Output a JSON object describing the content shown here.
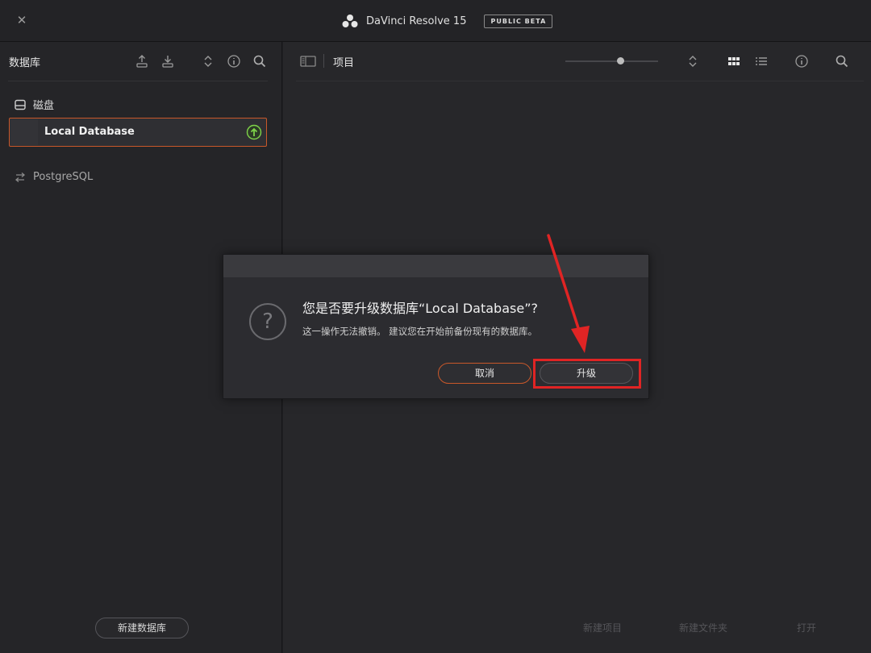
{
  "window": {
    "close_icon": "close-icon",
    "title": "DaVinci Resolve 15",
    "badge": "PUBLIC BETA"
  },
  "left_panel": {
    "title": "数据库",
    "section_label": "磁盘",
    "database_item": "Local Database",
    "network_item": "PostgreSQL",
    "new_database_button": "新建数据库"
  },
  "right_panel": {
    "title": "项目",
    "footer": {
      "new_project": "新建项目",
      "new_folder": "新建文件夹",
      "open": "打开"
    }
  },
  "dialog": {
    "title": "您是否要升级数据库“Local Database”?",
    "message": "这一操作无法撤销。 建议您在开始前备份现有的数据库。",
    "cancel_button": "取消",
    "upgrade_button": "升级"
  },
  "colors": {
    "accent_orange": "#c9582a",
    "annotation_red": "#e02424",
    "upgrade_green": "#7fd34a"
  }
}
